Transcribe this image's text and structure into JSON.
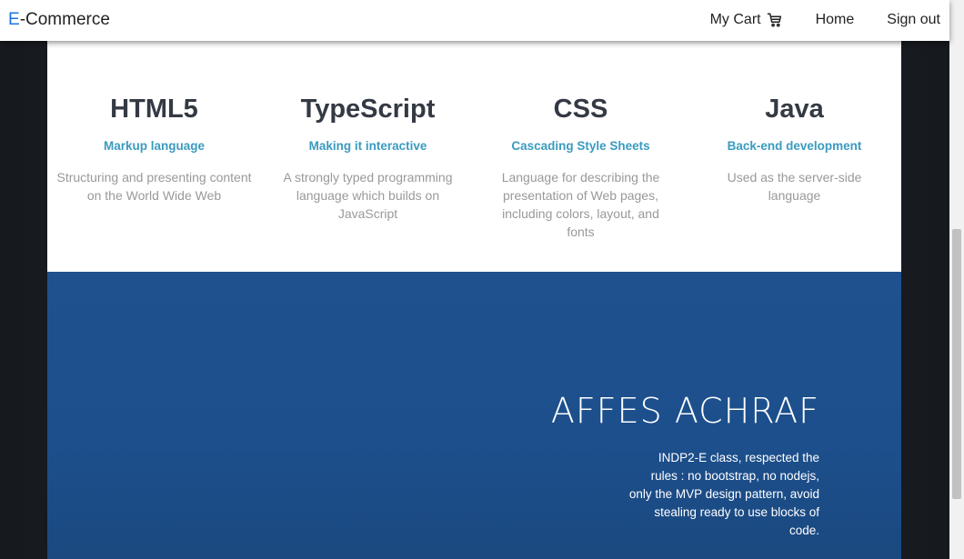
{
  "navbar": {
    "brand_accent": "E",
    "brand_rest": "-Commerce",
    "cart_label": "My Cart",
    "home_label": "Home",
    "signout_label": "Sign out"
  },
  "features": [
    {
      "title": "HTML5",
      "subtitle": "Markup language",
      "desc": "Structuring and presenting content on the World Wide Web"
    },
    {
      "title": "TypeScript",
      "subtitle": "Making it interactive",
      "desc": "A strongly typed programming language which builds on JavaScript"
    },
    {
      "title": "CSS",
      "subtitle": "Cascading Style Sheets",
      "desc": "Language for describing the presentation of Web pages, including colors, layout, and fonts"
    },
    {
      "title": "Java",
      "subtitle": "Back-end development",
      "desc": "Used as the server-side language"
    }
  ],
  "hero": {
    "name": "AFFES ACHRAF",
    "desc": "INDP2-E class, respected the rules : no bootstrap, no nodejs, only the MVP design pattern, avoid stealing ready to use blocks of code."
  },
  "colors": {
    "brand_accent": "#1a73e8",
    "feature_subtitle": "#3a9bbf",
    "hero_bg": "#1f518f"
  },
  "icons": {
    "cart": "shopping-cart-icon"
  }
}
